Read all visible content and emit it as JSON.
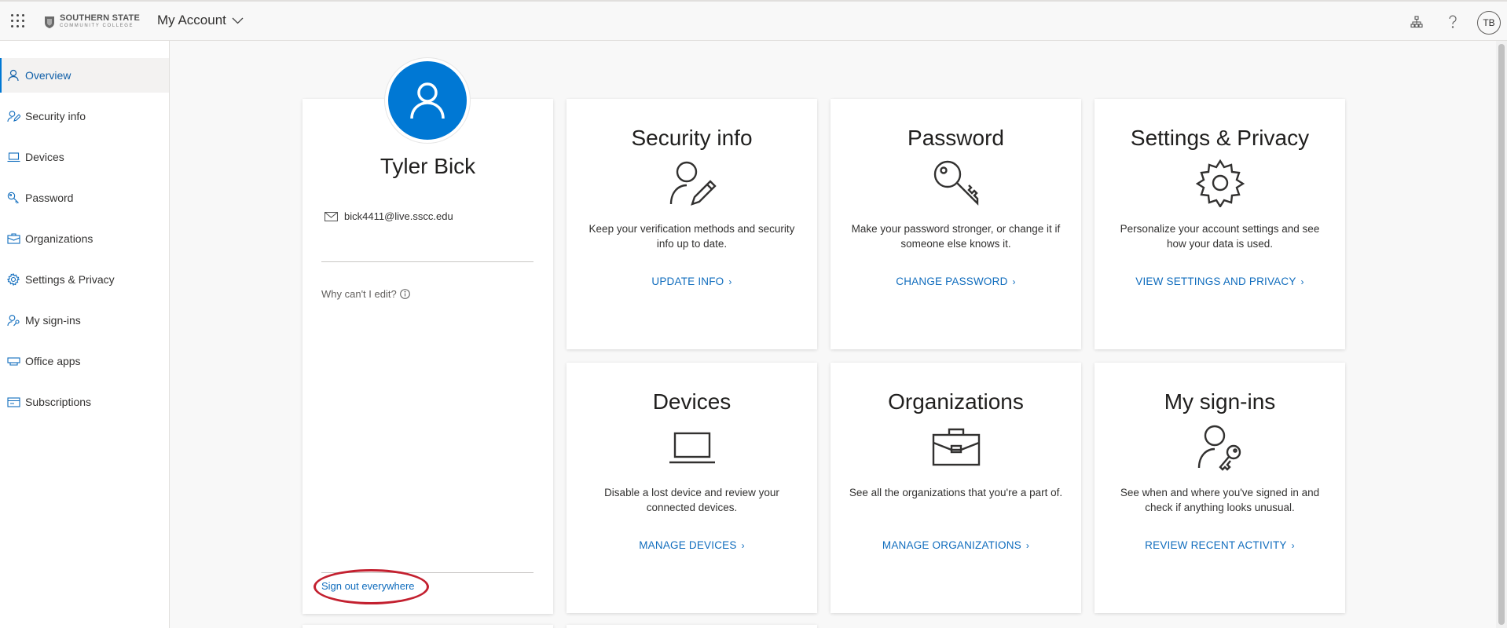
{
  "header": {
    "logo_line1": "SOUTHERN STATE",
    "logo_line2": "COMMUNITY COLLEGE",
    "app_title": "My Account",
    "avatar_initials": "TB",
    "icons": [
      "waffle-icon",
      "org-chart-icon",
      "help-icon",
      "chevron-down-icon"
    ]
  },
  "sidebar": {
    "items": [
      {
        "label": "Overview",
        "icon": "person-icon"
      },
      {
        "label": "Security info",
        "icon": "person-edit-icon"
      },
      {
        "label": "Devices",
        "icon": "laptop-icon"
      },
      {
        "label": "Password",
        "icon": "key-icon"
      },
      {
        "label": "Organizations",
        "icon": "briefcase-icon"
      },
      {
        "label": "Settings & Privacy",
        "icon": "gear-icon"
      },
      {
        "label": "My sign-ins",
        "icon": "person-key-icon"
      },
      {
        "label": "Office apps",
        "icon": "office-apps-icon"
      },
      {
        "label": "Subscriptions",
        "icon": "subscriptions-icon"
      }
    ]
  },
  "profile": {
    "name": "Tyler Bick",
    "email": "bick4411@live.sscc.edu",
    "cant_edit": "Why can't I edit?",
    "signout": "Sign out everywhere"
  },
  "tiles": [
    {
      "title": "Security info",
      "desc": "Keep your verification methods and security info up to date.",
      "link": "UPDATE INFO",
      "icon": "person-edit-icon"
    },
    {
      "title": "Password",
      "desc": "Make your password stronger, or change it if someone else knows it.",
      "link": "CHANGE PASSWORD",
      "icon": "key-icon"
    },
    {
      "title": "Settings & Privacy",
      "desc": "Personalize your account settings and see how your data is used.",
      "link": "VIEW SETTINGS AND PRIVACY",
      "icon": "gear-icon"
    },
    {
      "title": "Devices",
      "desc": "Disable a lost device and review your connected devices.",
      "link": "MANAGE DEVICES",
      "icon": "laptop-icon"
    },
    {
      "title": "Organizations",
      "desc": "See all the organizations that you're a part of.",
      "link": "MANAGE ORGANIZATIONS",
      "icon": "briefcase-icon"
    },
    {
      "title": "My sign-ins",
      "desc": "See when and where you've signed in and check if anything looks unusual.",
      "link": "REVIEW RECENT ACTIVITY",
      "icon": "person-key-icon"
    }
  ],
  "colors": {
    "accent": "#0078d4",
    "link": "#0f6cbd",
    "annotation": "#c3202f"
  }
}
